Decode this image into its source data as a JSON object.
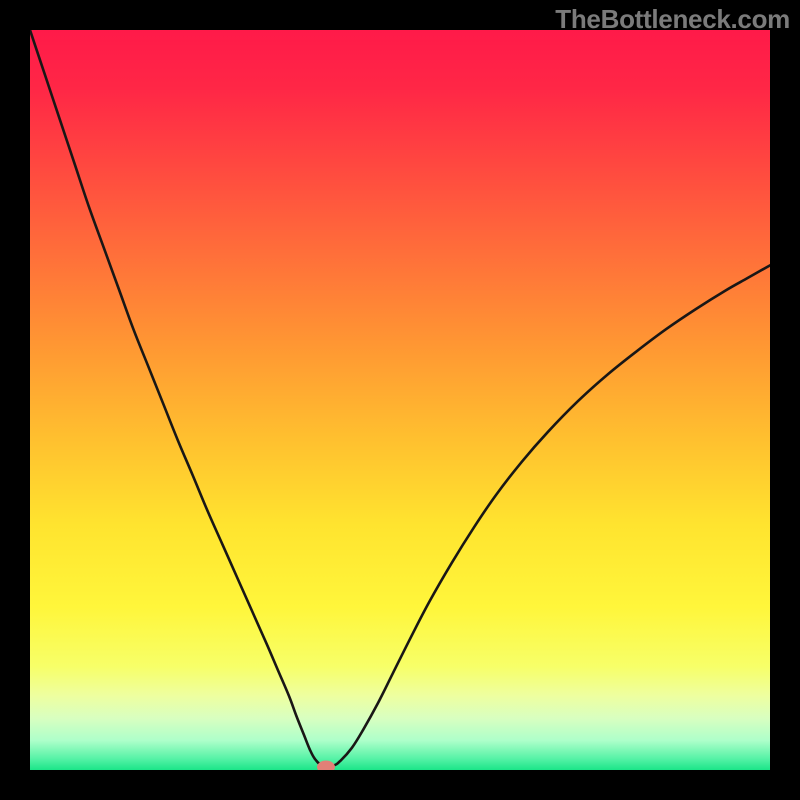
{
  "watermark": "TheBottleneck.com",
  "colors": {
    "black": "#000000",
    "curve": "#191716",
    "gradient_stops": [
      {
        "offset": 0.0,
        "color": "#ff1a49"
      },
      {
        "offset": 0.08,
        "color": "#ff2746"
      },
      {
        "offset": 0.18,
        "color": "#ff4740"
      },
      {
        "offset": 0.3,
        "color": "#ff6e3a"
      },
      {
        "offset": 0.42,
        "color": "#ff9533"
      },
      {
        "offset": 0.55,
        "color": "#ffbf2f"
      },
      {
        "offset": 0.67,
        "color": "#ffe42f"
      },
      {
        "offset": 0.78,
        "color": "#fff63b"
      },
      {
        "offset": 0.86,
        "color": "#f7ff68"
      },
      {
        "offset": 0.9,
        "color": "#eeffa0"
      },
      {
        "offset": 0.93,
        "color": "#d8ffc0"
      },
      {
        "offset": 0.96,
        "color": "#aeffca"
      },
      {
        "offset": 0.985,
        "color": "#55f2a6"
      },
      {
        "offset": 1.0,
        "color": "#1be588"
      }
    ],
    "marker": "#e28077"
  },
  "chart_data": {
    "type": "line",
    "title": "",
    "xlabel": "",
    "ylabel": "",
    "xlim": [
      0,
      100
    ],
    "ylim": [
      0,
      100
    ],
    "legend": false,
    "grid": false,
    "series": [
      {
        "name": "bottleneck-curve",
        "x": [
          0.0,
          2.0,
          4.0,
          6.0,
          8.0,
          10.0,
          12.0,
          14.0,
          16.0,
          18.0,
          20.0,
          22.0,
          24.0,
          26.0,
          28.0,
          30.0,
          32.0,
          33.5,
          35.0,
          36.0,
          37.0,
          37.8,
          38.5,
          39.5,
          41.0,
          42.0,
          43.5,
          45.0,
          47.0,
          49.0,
          51.5,
          54.0,
          57.0,
          60.0,
          63.0,
          66.5,
          70.0,
          74.0,
          78.0,
          82.0,
          86.0,
          90.0,
          94.0,
          97.0,
          100.0
        ],
        "y": [
          100.0,
          94.0,
          88.0,
          82.0,
          76.0,
          70.5,
          65.0,
          59.5,
          54.5,
          49.5,
          44.5,
          39.8,
          35.0,
          30.5,
          26.0,
          21.5,
          17.0,
          13.5,
          10.0,
          7.3,
          4.8,
          2.8,
          1.5,
          0.6,
          0.6,
          1.3,
          3.0,
          5.4,
          9.0,
          13.0,
          18.0,
          22.8,
          28.0,
          32.8,
          37.2,
          41.7,
          45.7,
          49.8,
          53.4,
          56.6,
          59.6,
          62.3,
          64.8,
          66.5,
          68.2
        ]
      }
    ],
    "annotations": [
      {
        "name": "min-marker",
        "x": 40.0,
        "y": 0.4,
        "color": "#e28077"
      }
    ]
  }
}
